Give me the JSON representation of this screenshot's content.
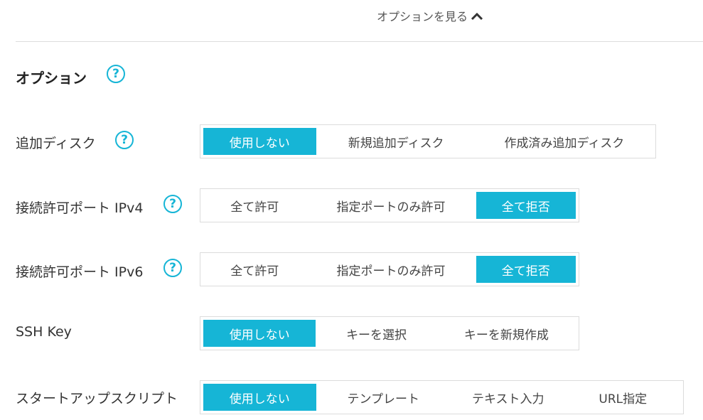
{
  "toggle": {
    "label": "オプションを見る"
  },
  "section": {
    "title": "オプション"
  },
  "rows": [
    {
      "label": "追加ディスク",
      "has_help": true,
      "options": [
        {
          "label": "使用しない",
          "selected": true
        },
        {
          "label": "新規追加ディスク",
          "selected": false
        },
        {
          "label": "作成済み追加ディスク",
          "selected": false
        }
      ]
    },
    {
      "label": "接続許可ポート IPv4",
      "has_help": true,
      "options": [
        {
          "label": "全て許可",
          "selected": false
        },
        {
          "label": "指定ポートのみ許可",
          "selected": false
        },
        {
          "label": "全て拒否",
          "selected": true
        }
      ]
    },
    {
      "label": "接続許可ポート IPv6",
      "has_help": true,
      "options": [
        {
          "label": "全て許可",
          "selected": false
        },
        {
          "label": "指定ポートのみ許可",
          "selected": false
        },
        {
          "label": "全て拒否",
          "selected": true
        }
      ]
    },
    {
      "label": "SSH Key",
      "has_help": false,
      "options": [
        {
          "label": "使用しない",
          "selected": true
        },
        {
          "label": "キーを選択",
          "selected": false
        },
        {
          "label": "キーを新規作成",
          "selected": false
        }
      ]
    },
    {
      "label": "スタートアップスクリプト",
      "has_help": false,
      "options": [
        {
          "label": "使用しない",
          "selected": true
        },
        {
          "label": "テンプレート",
          "selected": false
        },
        {
          "label": "テキスト入力",
          "selected": false
        },
        {
          "label": "URL指定",
          "selected": false
        }
      ]
    }
  ],
  "help_glyph": "?",
  "icons": {
    "toggle": "chevron-up-icon",
    "help": "help-circle-icon"
  },
  "colors": {
    "accent": "#16b5d6",
    "border": "#dcdcdc",
    "text": "#333333"
  }
}
